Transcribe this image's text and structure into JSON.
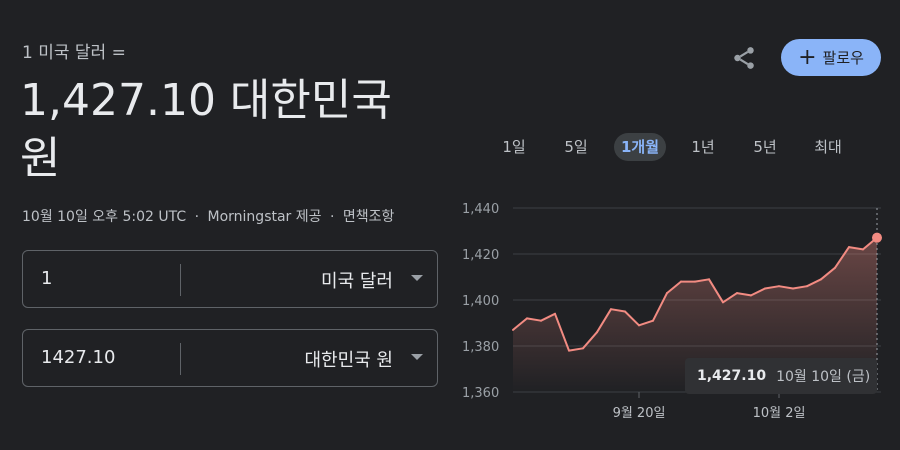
{
  "header": {
    "from_line": "1 미국 달러 =",
    "result": "1,427.10 대한민국 원",
    "timestamp": "10월 10일 오후 5:02 UTC",
    "separator": "·",
    "source": "Morningstar 제공",
    "disclaimer": "면책조항"
  },
  "actions": {
    "share_icon": "share-icon",
    "follow_label": "팔로우",
    "follow_icon": "+"
  },
  "converter": {
    "from_amount": "1",
    "from_currency": "미국 달러",
    "to_amount": "1427.10",
    "to_currency": "대한민국 원"
  },
  "range_tabs": [
    {
      "label": "1일",
      "active": false
    },
    {
      "label": "5일",
      "active": false
    },
    {
      "label": "1개월",
      "active": true
    },
    {
      "label": "1년",
      "active": false
    },
    {
      "label": "5년",
      "active": false
    },
    {
      "label": "최대",
      "active": false
    }
  ],
  "chart_data": {
    "type": "area",
    "y_ticks": [
      "1,440",
      "1,420",
      "1,400",
      "1,380",
      "1,360"
    ],
    "ylim": [
      1360,
      1440
    ],
    "x_ticks": [
      {
        "label": "9월 20일",
        "index": 9
      },
      {
        "label": "10월 2일",
        "index": 19
      }
    ],
    "values": [
      1387,
      1392,
      1391,
      1394,
      1378,
      1379,
      1386,
      1396,
      1395,
      1389,
      1391,
      1403,
      1408,
      1408,
      1409,
      1399,
      1403,
      1402,
      1405,
      1406,
      1405,
      1406,
      1409,
      1414,
      1423,
      1422,
      1427.1
    ],
    "line_color": "#f28b82",
    "hover": {
      "value": "1,427.10",
      "date": "10월 10일 (금)"
    }
  },
  "colors": {
    "background": "#202124",
    "accent": "#8ab4f8",
    "series": "#f28b82"
  }
}
